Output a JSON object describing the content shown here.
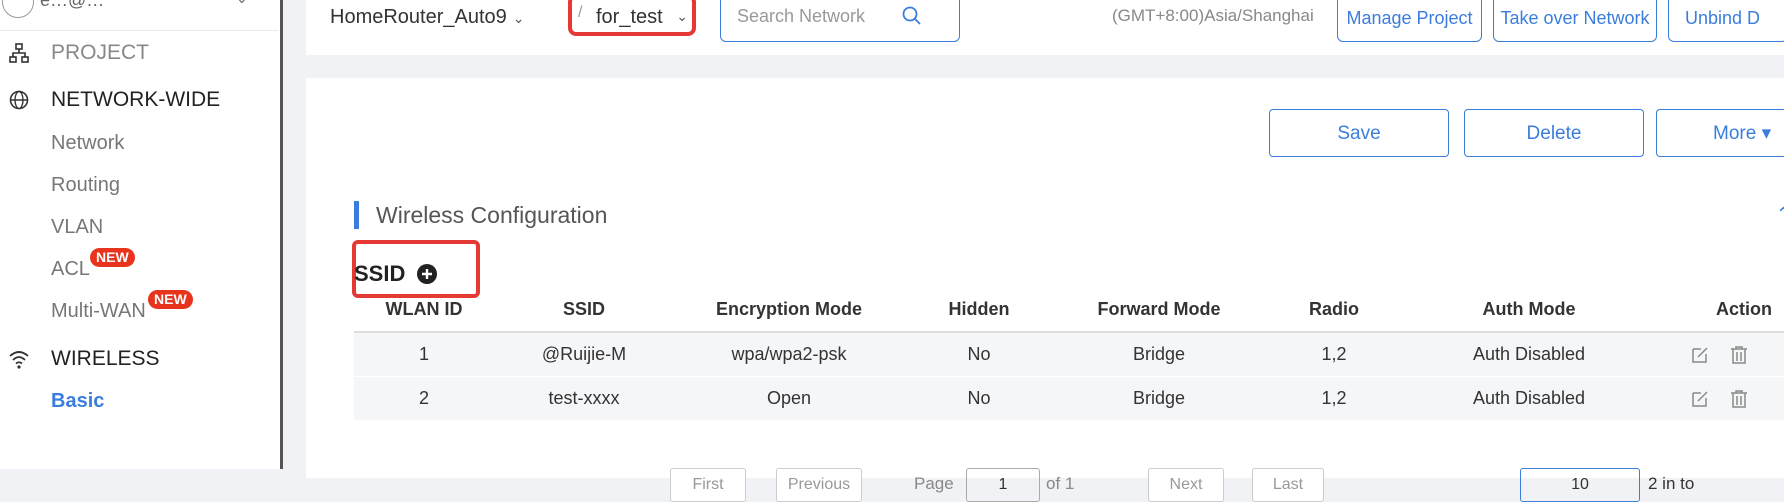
{
  "sidebar": {
    "user_text": "e…@…",
    "sections": [
      {
        "label": "PROJECT",
        "icon": "sitemap-icon"
      },
      {
        "label": "NETWORK-WIDE",
        "icon": "globe-icon"
      },
      {
        "label": "WIRELESS",
        "icon": "wifi-icon"
      }
    ],
    "items": [
      {
        "label": "Network"
      },
      {
        "label": "Routing"
      },
      {
        "label": "VLAN"
      },
      {
        "label": "ACL",
        "badge": "NEW"
      },
      {
        "label": "Multi-WAN",
        "badge": "NEW"
      },
      {
        "label": "Basic",
        "active": true
      }
    ]
  },
  "topbar": {
    "project": "HomeRouter_Auto9",
    "network_prefix": "/",
    "network": "for_test",
    "search_placeholder": "Search Network",
    "timezone": "(GMT+8:00)Asia/Shanghai",
    "buttons": [
      "Manage Project",
      "Take over Network",
      "Unbind D"
    ]
  },
  "actions": {
    "save": "Save",
    "delete": "Delete",
    "more": "More ▾"
  },
  "section": {
    "title": "Wireless Configuration",
    "ssid_label": "SSID"
  },
  "table": {
    "headers": [
      "WLAN ID",
      "SSID",
      "Encryption Mode",
      "Hidden",
      "Forward Mode",
      "Radio",
      "Auth Mode",
      "Action"
    ],
    "rows": [
      [
        "1",
        "@Ruijie-M",
        "wpa/wpa2-psk",
        "No",
        "Bridge",
        "1,2",
        "Auth Disabled"
      ],
      [
        "2",
        "test-xxxx",
        "Open",
        "No",
        "Bridge",
        "1,2",
        "Auth Disabled"
      ]
    ]
  },
  "pager": {
    "first": "First",
    "previous": "Previous",
    "page_label": "Page",
    "page_value": "1",
    "of_label": "of 1",
    "next": "Next",
    "last": "Last",
    "page_size": "10",
    "total": "2 in to"
  },
  "colors": {
    "accent": "#3b7ddd",
    "highlight": "#e53935",
    "badge": "#e8341c"
  }
}
